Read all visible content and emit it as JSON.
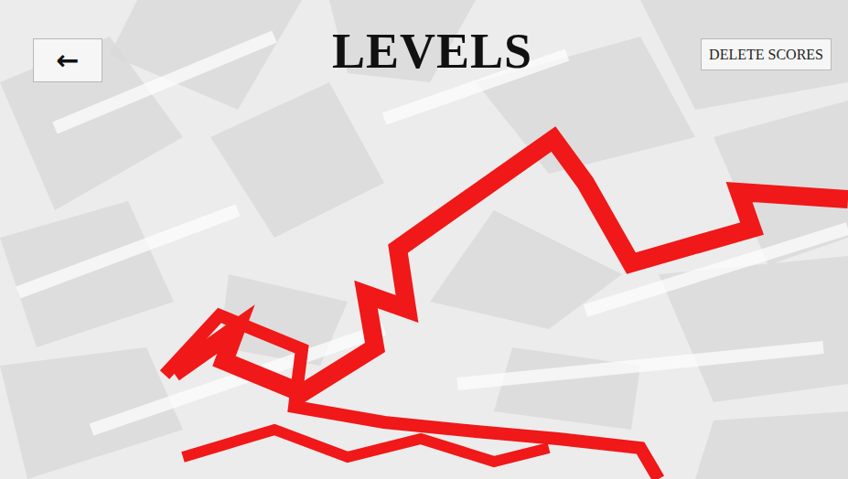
{
  "back_button": {
    "label": "←"
  },
  "title": "LEVELS",
  "delete_button": {
    "label": "DELETE SCORES"
  }
}
